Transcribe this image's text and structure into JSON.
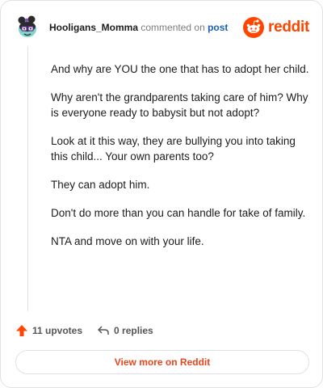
{
  "header": {
    "username": "Hooligans_Momma",
    "action_text": "commented on",
    "post_link": "post",
    "brand": "reddit",
    "avatar_icon": "snoo-avatar-icon",
    "logo_icon": "reddit-snoo-icon"
  },
  "comment": {
    "paragraphs": [
      "And why are YOU the one that has to adopt her child.",
      "Why aren't the grandparents taking care of him? Why is everyone ready to babysit but not adopt?",
      "Look at it this way, they are bullying you into taking this child... Your own parents too?",
      "They can adopt him.",
      "Don't do more than you can handle for take of family.",
      "NTA and move on with your life."
    ]
  },
  "actions": {
    "upvotes": "11 upvotes",
    "replies": "0 replies",
    "upvote_icon": "upvote-arrow-icon",
    "reply_icon": "reply-arrow-icon"
  },
  "footer": {
    "view_more": "View more on Reddit"
  },
  "colors": {
    "brand": "#ff4500",
    "link": "#1a5fb4",
    "cta": "#e8461d"
  }
}
